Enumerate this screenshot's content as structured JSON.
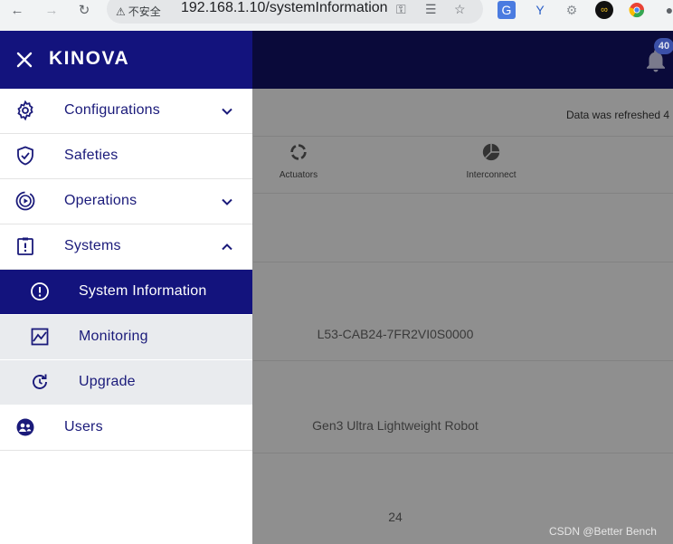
{
  "browser": {
    "security_label": "不安全",
    "url": "192.168.1.10/systemInformation"
  },
  "header": {
    "notification_count": "40"
  },
  "page": {
    "refresh_text": "Data was refreshed 4",
    "tabs": [
      "Actuators",
      "Interconnect"
    ],
    "values": [
      "L53-CAB24-7FR2VI0S0000",
      "Gen3 Ultra Lightweight Robot",
      "24"
    ]
  },
  "drawer": {
    "logo_text": "KINOVA",
    "items": [
      {
        "label": "Configurations",
        "icon": "gear-icon"
      },
      {
        "label": "Safeties",
        "icon": "shield-icon"
      },
      {
        "label": "Operations",
        "icon": "play-circle-icon"
      },
      {
        "label": "Systems",
        "icon": "clipboard-alert-icon"
      },
      {
        "label": "System Information",
        "icon": "info-circle-icon"
      },
      {
        "label": "Monitoring",
        "icon": "chart-icon"
      },
      {
        "label": "Upgrade",
        "icon": "refresh-icon"
      },
      {
        "label": "Users",
        "icon": "users-icon"
      }
    ]
  },
  "watermark": "CSDN @Better Bench",
  "colors": {
    "drawer_header": "#13137d",
    "app_header": "#0a0a3a",
    "active_item": "#13137d",
    "label_text": "#1a1a7a",
    "submenu_bg": "#e9ebee"
  }
}
